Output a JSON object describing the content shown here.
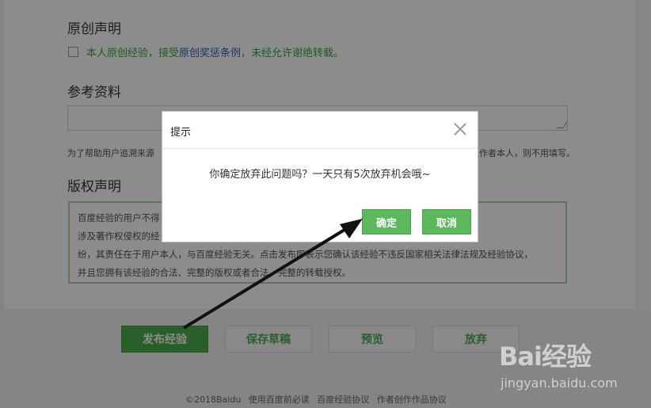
{
  "original": {
    "heading": "原创声明",
    "checkbox_text_a": "本人原创经验，接受",
    "checkbox_link": "原创奖惩条例",
    "checkbox_text_b": "，未经允许谢绝转载。"
  },
  "reference": {
    "heading": "参考资料",
    "hint_left": "为了帮助用户追溯来源",
    "hint_right": "是作者本人，则不用填写。"
  },
  "copyright": {
    "heading": "版权声明",
    "lines": [
      "百度经验的用户不得　　　　　　　　　　　　　　　　　　　　　　　　　　　的情况下转载任何",
      "涉及著作权侵权的经　　　　　　　　　　　　　　　　　　　　　　　　　　　纠纷或其他法律纠",
      "纷，其责任在于用户本人，与百度经验无关。点击发布即表示您确认该经验不违反国家相关法律法规及经验协议，",
      "并且您拥有该经验的合法、完整的版权或者合法、完整的转载授权。"
    ]
  },
  "actions": {
    "publish": "发布经验",
    "save_draft": "保存草稿",
    "preview": "预览",
    "abandon": "放弃"
  },
  "footer": {
    "links": [
      "©2018Baidu",
      "使用百度前必读",
      "百度经验协议",
      "作者创作作品协议"
    ]
  },
  "dialog": {
    "title": "提示",
    "message": "你确定放弃此问题吗？一天只有5次放弃机会哦~",
    "confirm": "确定",
    "cancel": "取消"
  },
  "watermark": {
    "logo": "Bai经验",
    "url": "jingyan.baidu.com"
  },
  "colors": {
    "primary_green": "#4cae4c",
    "link_blue": "#2d64b3",
    "accent_green_text": "#3aa83a"
  }
}
